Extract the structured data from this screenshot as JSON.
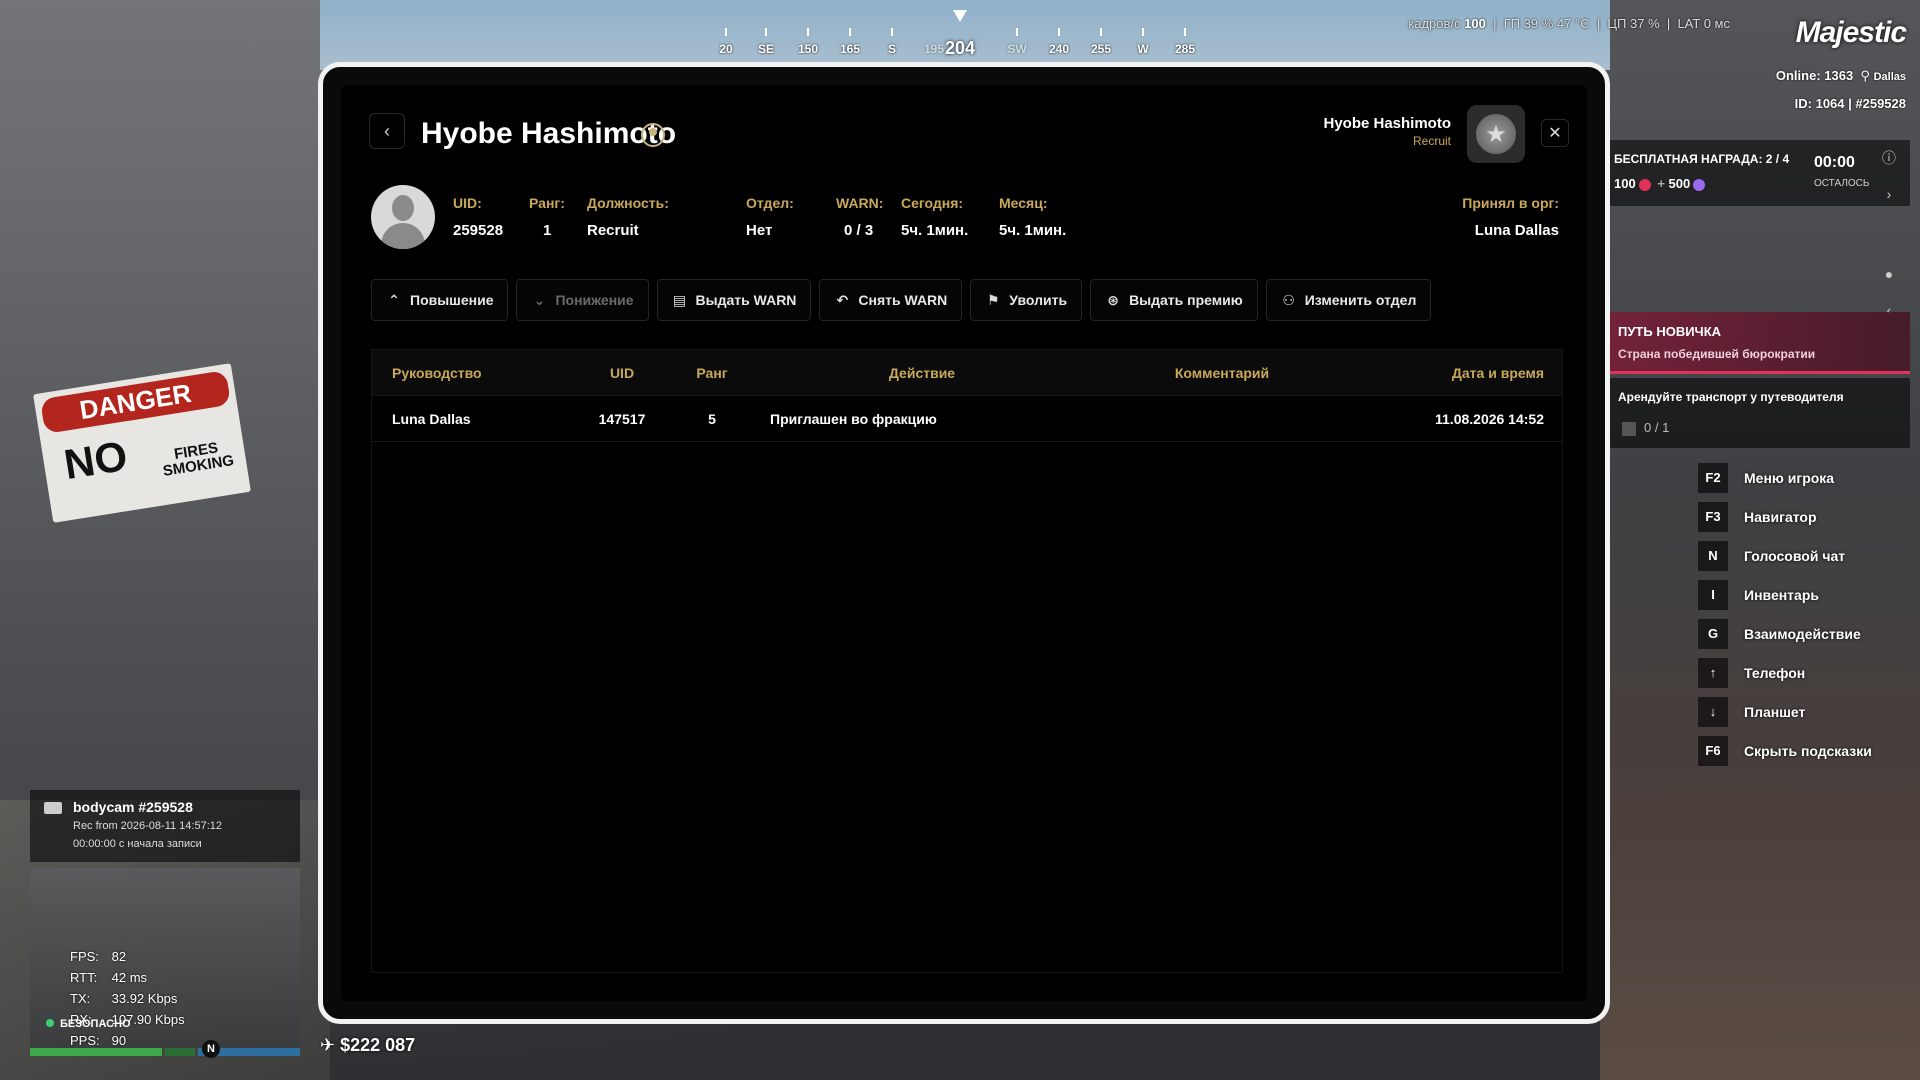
{
  "hud": {
    "fps_label": "кадров/с",
    "fps": "100",
    "gpu": "ГП 39 % 47 °C",
    "cpu": "ЦП 37 %",
    "lat": "LAT 0 мс",
    "logo": "Majestic",
    "online": "Online: 1363",
    "server": "Dallas",
    "id_line": "ID: 1064 | #259528",
    "compass": {
      "heading": "204",
      "labels": [
        "20",
        "SE",
        "150",
        "165",
        "S",
        "195",
        "204",
        "SW",
        "240",
        "255",
        "W",
        "285"
      ]
    }
  },
  "reward": {
    "title": "БЕСПЛАТНАЯ НАГРАДА: 2 / 4",
    "value_a": "100",
    "plus": "+",
    "value_b": "500",
    "timer": "00:00",
    "remain": "ОСТАЛОСЬ"
  },
  "newbie": {
    "title": "ПУТЬ НОВИЧКА",
    "subtitle": "Страна победившей бюрократии",
    "quest": "Арендуйте транспорт у путеводителя",
    "progress": "0 / 1"
  },
  "hints": [
    {
      "key": "F2",
      "label": "Меню игрока"
    },
    {
      "key": "F3",
      "label": "Навигатор"
    },
    {
      "key": "N",
      "label": "Голосовой чат"
    },
    {
      "key": "I",
      "label": "Инвентарь"
    },
    {
      "key": "G",
      "label": "Взаимодействие"
    },
    {
      "key": "↑",
      "label": "Телефон"
    },
    {
      "key": "↓",
      "label": "Планшет"
    },
    {
      "key": "F6",
      "label": "Скрыть подсказки"
    }
  ],
  "bodycam": {
    "title": "bodycam #259528",
    "line1": "Rec from 2026-08-11 14:57:12",
    "line2": "00:00:00 с начала записи"
  },
  "net": {
    "fps_k": "FPS:",
    "fps_v": "82",
    "rtt_k": "RTT:",
    "rtt_v": "42 ms",
    "tx_k": "TX:",
    "tx_v": "33.92 Kbps",
    "rx_k": "RX:",
    "rx_v": "107.90 Kbps",
    "pps_k": "PPS:",
    "pps_v": "90",
    "safe": "БЕЗОПАСНО",
    "compass_n": "N"
  },
  "money": "$222 087",
  "profile": {
    "name": "Hyobe Hashimoto",
    "me_name": "Hyobe Hashimoto",
    "me_rank": "Recruit",
    "uid_k": "UID:",
    "uid_v": "259528",
    "rank_k": "Ранг:",
    "rank_v": "1",
    "post_k": "Должность:",
    "post_v": "Recruit",
    "dept_k": "Отдел:",
    "dept_v": "Нет",
    "warn_k": "WARN:",
    "warn_v": "0 / 3",
    "today_k": "Сегодня:",
    "today_v": "5ч. 1мин.",
    "month_k": "Месяц:",
    "month_v": "5ч. 1мин.",
    "accepted_k": "Принял в орг:",
    "accepted_v": "Luna Dallas"
  },
  "actions": {
    "promote": "Повышение",
    "demote": "Понижение",
    "give_warn": "Выдать WARN",
    "remove_warn": "Снять WARN",
    "fire": "Уволить",
    "bonus": "Выдать премию",
    "change_dept": "Изменить отдел"
  },
  "table": {
    "headers": [
      "Руководство",
      "UID",
      "Ранг",
      "Действие",
      "Комментарий",
      "Дата и время"
    ],
    "rows": [
      {
        "leader": "Luna Dallas",
        "uid": "147517",
        "rank": "5",
        "action": "Приглашен во фракцию",
        "comment": "",
        "datetime": "11.08.2026 14:52"
      }
    ]
  }
}
